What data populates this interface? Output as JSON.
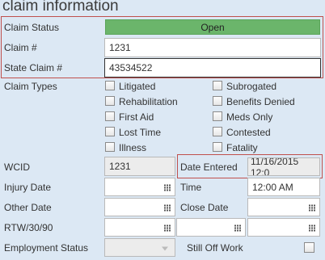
{
  "title": "claim information",
  "claim_status": {
    "label": "Claim Status",
    "value": "Open"
  },
  "claim_number": {
    "label": "Claim #",
    "value": "1231"
  },
  "state_claim_number": {
    "label": "State Claim #",
    "value": "43534522"
  },
  "claim_types": {
    "label": "Claim Types",
    "left": [
      {
        "label": "Litigated",
        "checked": false
      },
      {
        "label": "Rehabilitation",
        "checked": false
      },
      {
        "label": "First Aid",
        "checked": false
      },
      {
        "label": "Lost Time",
        "checked": false
      },
      {
        "label": "Illness",
        "checked": false
      }
    ],
    "right": [
      {
        "label": "Subrogated",
        "checked": false
      },
      {
        "label": "Benefits Denied",
        "checked": false
      },
      {
        "label": "Meds Only",
        "checked": false
      },
      {
        "label": "Contested",
        "checked": false
      },
      {
        "label": "Fatality",
        "checked": false
      }
    ]
  },
  "wcid": {
    "label": "WCID",
    "value": "1231"
  },
  "date_entered": {
    "label": "Date Entered",
    "value": "11/16/2015 12:0"
  },
  "injury_date": {
    "label": "Injury Date",
    "value": ""
  },
  "time": {
    "label": "Time",
    "value": "12:00 AM"
  },
  "other_date": {
    "label": "Other Date",
    "value": ""
  },
  "close_date": {
    "label": "Close Date",
    "value": ""
  },
  "rtw": {
    "label": "RTW/30/90",
    "values": [
      "",
      "",
      ""
    ]
  },
  "employment_status": {
    "label": "Employment Status",
    "value": ""
  },
  "still_off_work": {
    "label": "Still Off Work",
    "checked": false
  },
  "colors": {
    "status_green": "#6bb56b",
    "highlight_red": "#c0504d",
    "background": "#dce8f4"
  }
}
